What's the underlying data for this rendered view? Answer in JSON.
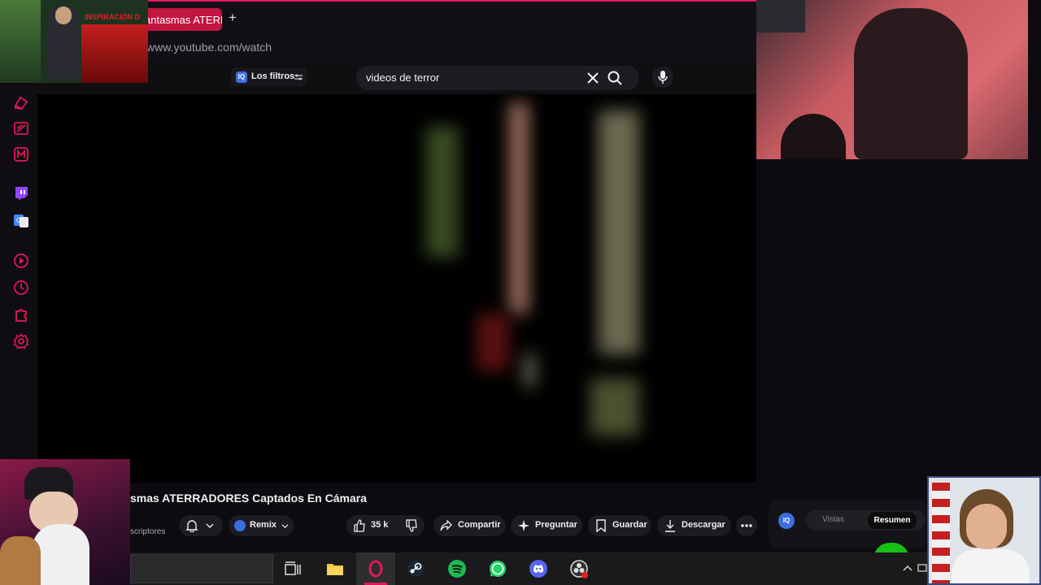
{
  "browser": {
    "tab_title": "antasmas ATERRADORES Captados En Cámara",
    "new_tab": "+",
    "url": "www.youtube.com/watch"
  },
  "thumbnail_overlay": {
    "label": "INSPIRACIÓN D"
  },
  "header": {
    "filters_icon": "IQ",
    "filters_label": "Los filtros",
    "search_value": "videos de terror"
  },
  "sidebar": {
    "icons": [
      "books-icon",
      "slash-icon",
      "m-icon",
      "twitch-icon",
      "translate-icon",
      "play-icon",
      "clock-icon",
      "puzzle-icon",
      "gear-icon"
    ]
  },
  "video": {
    "title": "smas ATERRADORES Captados En Cámara",
    "subscribers_label": "scriptores"
  },
  "actions": {
    "remix": "Remix",
    "likes": "35 k",
    "share": "Compartir",
    "ask": "Preguntar",
    "save": "Guardar",
    "download": "Descargar"
  },
  "panel": {
    "icon": "IQ",
    "tab_views": "Vistas",
    "tab_summary": "Resumen"
  },
  "colors": {
    "accent": "#e0185a",
    "brand_blue": "#3b6fe0",
    "spotify": "#1db954",
    "whatsapp": "#25d366",
    "discord": "#5865f2"
  }
}
